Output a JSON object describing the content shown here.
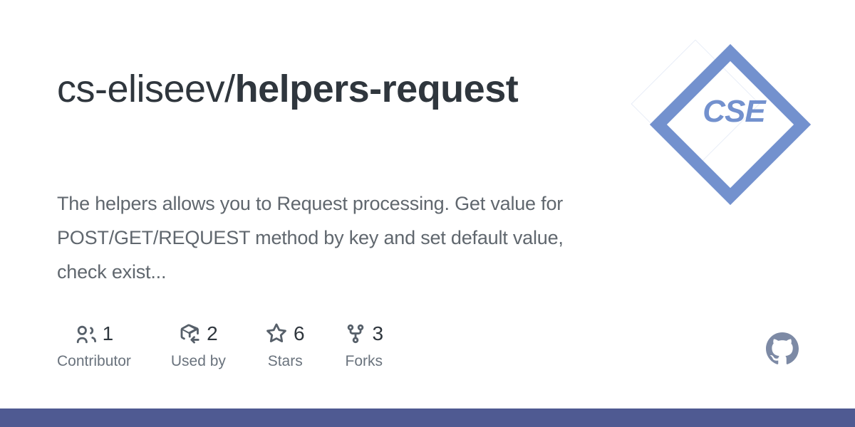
{
  "repository": {
    "owner": "cs-eliseev/",
    "name": "helpers-request",
    "description": "The helpers allows you to Request processing. Get value for POST/GET/REQUEST method by key and set default value, check exist..."
  },
  "logo": {
    "text": "CSE",
    "color": "#7391ce",
    "ghost_outline_color": "#e8edf7"
  },
  "stats": [
    {
      "icon": "people-icon",
      "value": "1",
      "label": "Contributor"
    },
    {
      "icon": "package-icon",
      "value": "2",
      "label": "Used by"
    },
    {
      "icon": "star-icon",
      "value": "6",
      "label": "Stars"
    },
    {
      "icon": "fork-icon",
      "value": "3",
      "label": "Forks"
    }
  ],
  "branding": {
    "github_mark": "github-mark-icon",
    "github_mark_color": "#7d8aa5"
  },
  "colors": {
    "title": "#2f363d",
    "description": "#60676e",
    "stat_label": "#6a737d",
    "bottom_band": "#4f5a92",
    "background": "#ffffff"
  }
}
